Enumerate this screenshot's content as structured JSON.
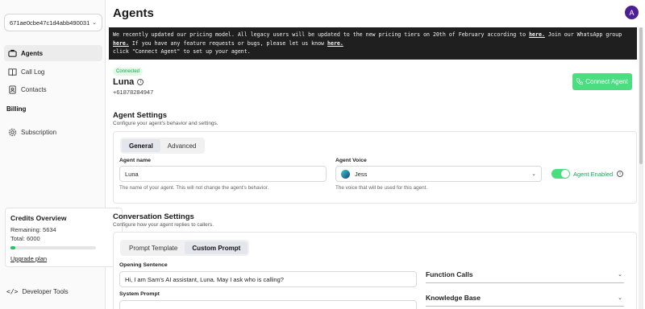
{
  "sidebar": {
    "org_id": "671ae0cbe47c1d4abb490031",
    "nav": [
      {
        "label": "Agents"
      },
      {
        "label": "Call Log"
      },
      {
        "label": "Contacts"
      }
    ],
    "billing_label": "Billing",
    "subscription_label": "Subscription",
    "credits": {
      "title": "Credits Overview",
      "remaining": "Remaining: 5634",
      "total": "Total: 6000",
      "used_fraction": 0.061,
      "upgrade_label": "Upgrade plan"
    },
    "developer_tools_label": "Developer Tools"
  },
  "header": {
    "title": "Agents",
    "avatar_initial": "A"
  },
  "banner": {
    "line1_a": "We recently updated our pricing model. All legacy users will be updated to the new pricing tiers on 20th of February according to ",
    "link1": "here.",
    "line1_b": " Join our WhatsApp group",
    "link2": "here.",
    "line2_a": " If you have any feature requests or bugs, please let us know ",
    "link3": "here.",
    "line3": "click \"Connect Agent\" to set up your agent."
  },
  "agent": {
    "status": "Connected",
    "name": "Luna",
    "phone": "+61878284947",
    "connect_label": "Connect Agent"
  },
  "agent_settings": {
    "title": "Agent Settings",
    "subtitle": "Configure your agent's behavior and settings.",
    "tabs": [
      {
        "label": "General"
      },
      {
        "label": "Advanced"
      }
    ],
    "name_label": "Agent name",
    "name_value": "Luna",
    "name_hint": "The name of your agent. This will not change the agent's behavior.",
    "voice_label": "Agent Voice",
    "voice_value": "Jess",
    "voice_hint": "The voice that will be used for this agent.",
    "enabled_label": "Agent Enabled",
    "enabled": true
  },
  "conversation_settings": {
    "title": "Conversation Settings",
    "subtitle": "Configure how your agent replies to callers.",
    "tabs": [
      {
        "label": "Prompt Template"
      },
      {
        "label": "Custom Prompt"
      }
    ],
    "opening_label": "Opening Sentence",
    "opening_value": "Hi, I am Sam's AI assistant, Luna. May I ask who is calling?",
    "system_prompt_label": "System Prompt",
    "accordions": [
      {
        "label": "Function Calls"
      },
      {
        "label": "Knowledge Base"
      }
    ]
  },
  "colors": {
    "accent_green": "#4ade80",
    "banner_bg": "#1f1f1f",
    "avatar_bg": "#4c1d95"
  }
}
